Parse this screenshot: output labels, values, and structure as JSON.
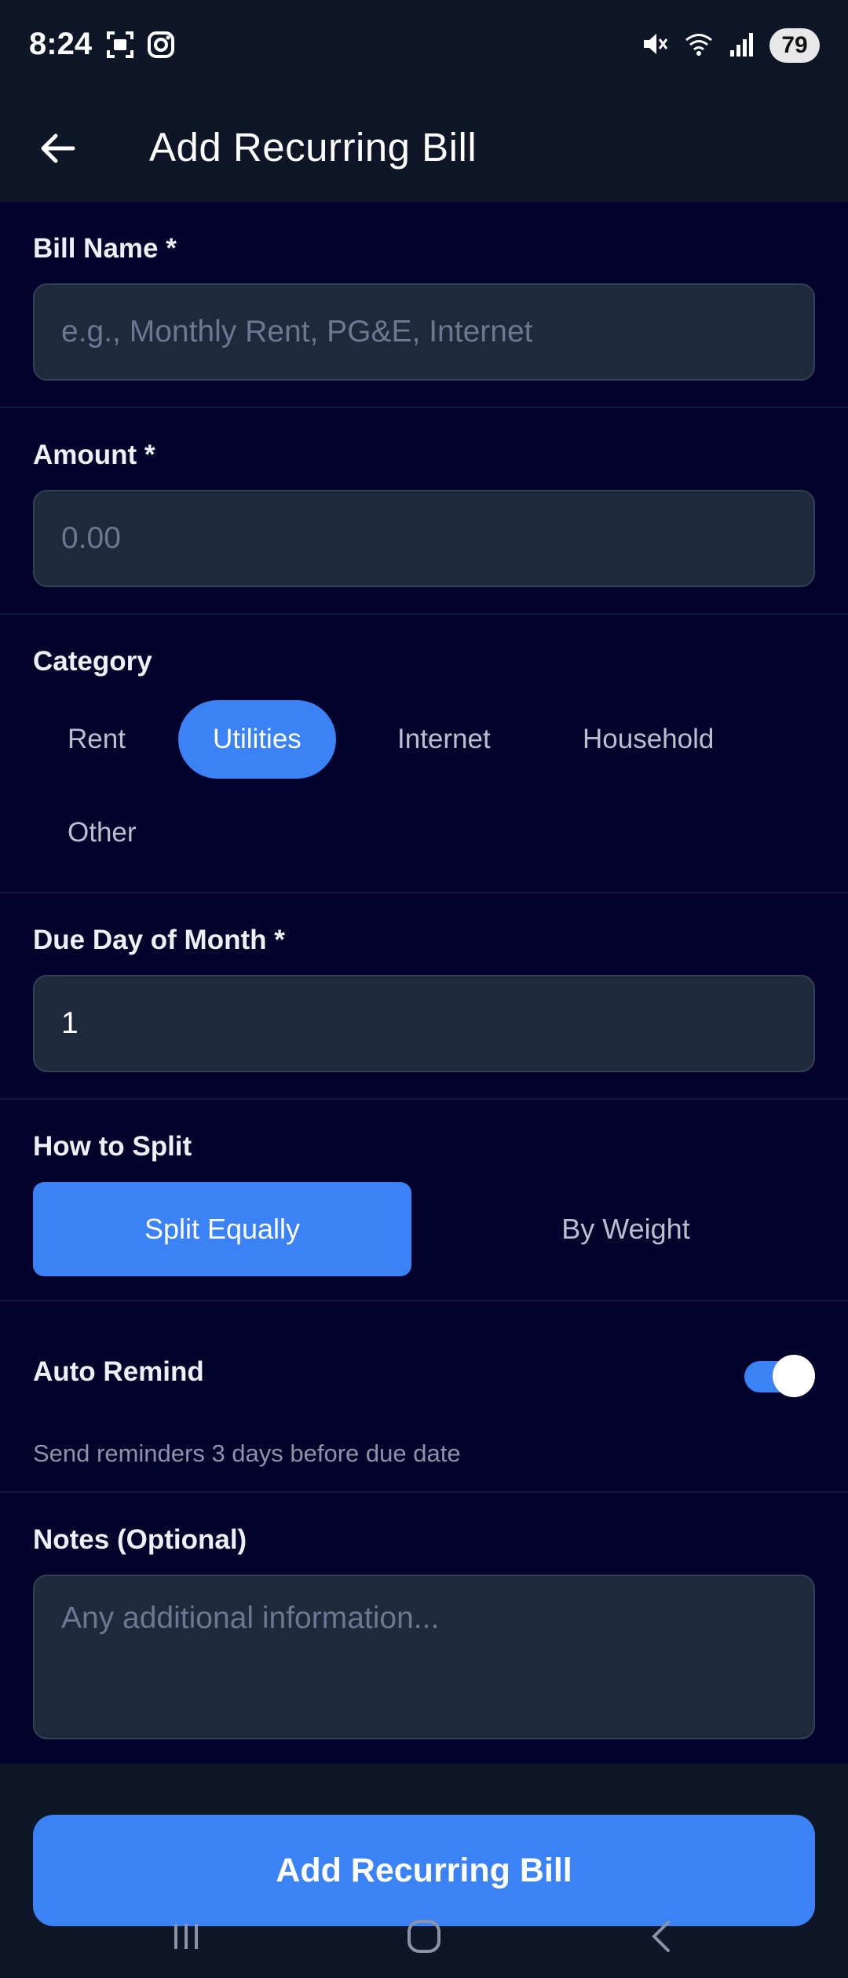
{
  "status_bar": {
    "time": "8:24",
    "battery": "79",
    "icons": [
      "screenshot-icon",
      "instagram-icon",
      "mute-icon",
      "wifi-icon",
      "signal-icon"
    ]
  },
  "app_bar": {
    "title": "Add Recurring Bill",
    "back_icon": "arrow-left-icon"
  },
  "form": {
    "bill_name": {
      "label": "Bill Name *",
      "placeholder": "e.g., Monthly Rent, PG&E, Internet"
    },
    "amount": {
      "label": "Amount *",
      "placeholder": "0.00"
    },
    "category": {
      "label": "Category",
      "options": [
        "Rent",
        "Utilities",
        "Internet",
        "Household",
        "Other"
      ],
      "selected": "Utilities"
    },
    "due_day": {
      "label": "Due Day of Month *",
      "value": "1"
    },
    "split": {
      "label": "How to Split",
      "options": [
        "Split Equally",
        "By Weight"
      ],
      "selected": "Split Equally"
    },
    "auto_remind": {
      "label": "Auto Remind",
      "enabled": true,
      "help": "Send reminders 3 days before due date"
    },
    "notes": {
      "label": "Notes (Optional)",
      "placeholder": "Any additional information..."
    }
  },
  "submit": {
    "label": "Add Recurring Bill"
  },
  "colors": {
    "background": "#03032b",
    "surface": "#0f1627",
    "input": "#1e293b",
    "accent": "#3b82f6"
  }
}
